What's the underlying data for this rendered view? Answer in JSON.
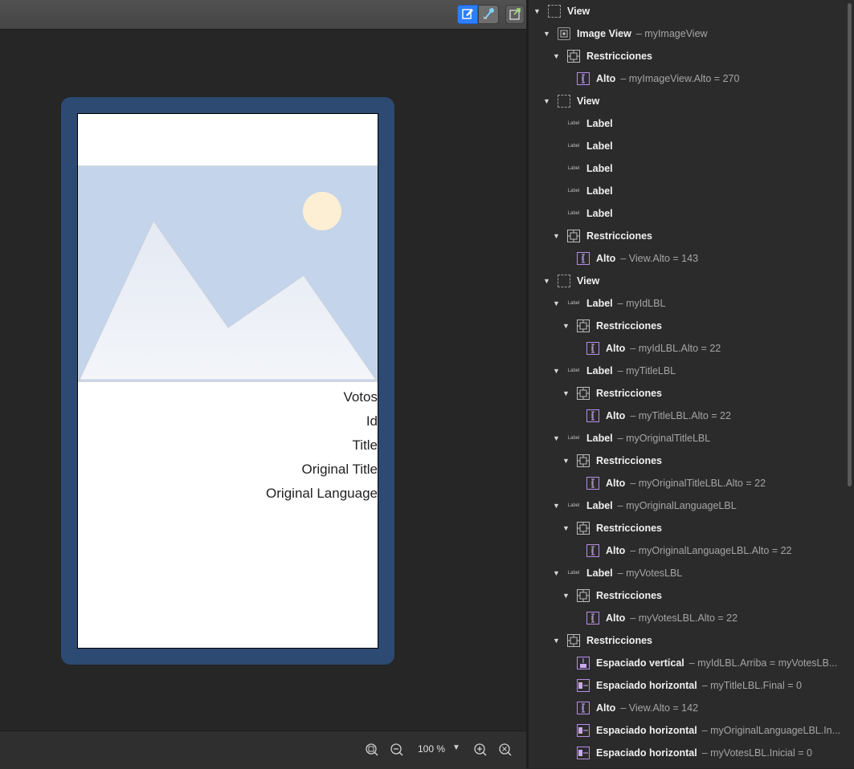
{
  "canvas": {
    "zoom_label": "100 %",
    "labels": [
      "Votos",
      "Id",
      "Title",
      "Original Title",
      "Original Language"
    ]
  },
  "outline": [
    {
      "depth": 0,
      "icon": "view",
      "name": "View",
      "detail": "",
      "expanded": true
    },
    {
      "depth": 1,
      "icon": "image",
      "name": "Image View",
      "detail": "– myImageView",
      "expanded": true
    },
    {
      "depth": 2,
      "icon": "constraints",
      "name": "Restricciones",
      "detail": "",
      "expanded": true
    },
    {
      "depth": 3,
      "icon": "constraint-height",
      "name": "Alto",
      "detail": "– myImageView.Alto = 270",
      "expanded": null
    },
    {
      "depth": 1,
      "icon": "view",
      "name": "View",
      "detail": "",
      "expanded": true
    },
    {
      "depth": 2,
      "icon": "label",
      "name": "Label",
      "detail": "",
      "expanded": null
    },
    {
      "depth": 2,
      "icon": "label",
      "name": "Label",
      "detail": "",
      "expanded": null
    },
    {
      "depth": 2,
      "icon": "label",
      "name": "Label",
      "detail": "",
      "expanded": null
    },
    {
      "depth": 2,
      "icon": "label",
      "name": "Label",
      "detail": "",
      "expanded": null
    },
    {
      "depth": 2,
      "icon": "label",
      "name": "Label",
      "detail": "",
      "expanded": null
    },
    {
      "depth": 2,
      "icon": "constraints",
      "name": "Restricciones",
      "detail": "",
      "expanded": true
    },
    {
      "depth": 3,
      "icon": "constraint-height",
      "name": "Alto",
      "detail": "– View.Alto = 143",
      "expanded": null
    },
    {
      "depth": 1,
      "icon": "view",
      "name": "View",
      "detail": "",
      "expanded": true
    },
    {
      "depth": 2,
      "icon": "label",
      "name": "Label",
      "detail": "– myIdLBL",
      "expanded": true
    },
    {
      "depth": 3,
      "icon": "constraints",
      "name": "Restricciones",
      "detail": "",
      "expanded": true
    },
    {
      "depth": 4,
      "icon": "constraint-height",
      "name": "Alto",
      "detail": "– myIdLBL.Alto = 22",
      "expanded": null
    },
    {
      "depth": 2,
      "icon": "label",
      "name": "Label",
      "detail": "– myTitleLBL",
      "expanded": true
    },
    {
      "depth": 3,
      "icon": "constraints",
      "name": "Restricciones",
      "detail": "",
      "expanded": true
    },
    {
      "depth": 4,
      "icon": "constraint-height",
      "name": "Alto",
      "detail": "– myTitleLBL.Alto = 22",
      "expanded": null
    },
    {
      "depth": 2,
      "icon": "label",
      "name": "Label",
      "detail": "– myOriginalTitleLBL",
      "expanded": true
    },
    {
      "depth": 3,
      "icon": "constraints",
      "name": "Restricciones",
      "detail": "",
      "expanded": true
    },
    {
      "depth": 4,
      "icon": "constraint-height",
      "name": "Alto",
      "detail": "– myOriginalTitleLBL.Alto = 22",
      "expanded": null
    },
    {
      "depth": 2,
      "icon": "label",
      "name": "Label",
      "detail": "– myOriginalLanguageLBL",
      "expanded": true
    },
    {
      "depth": 3,
      "icon": "constraints",
      "name": "Restricciones",
      "detail": "",
      "expanded": true
    },
    {
      "depth": 4,
      "icon": "constraint-height",
      "name": "Alto",
      "detail": "– myOriginalLanguageLBL.Alto = 22",
      "expanded": null
    },
    {
      "depth": 2,
      "icon": "label",
      "name": "Label",
      "detail": "– myVotesLBL",
      "expanded": true
    },
    {
      "depth": 3,
      "icon": "constraints",
      "name": "Restricciones",
      "detail": "",
      "expanded": true
    },
    {
      "depth": 4,
      "icon": "constraint-height",
      "name": "Alto",
      "detail": "– myVotesLBL.Alto = 22",
      "expanded": null
    },
    {
      "depth": 2,
      "icon": "constraints",
      "name": "Restricciones",
      "detail": "",
      "expanded": true
    },
    {
      "depth": 3,
      "icon": "constraint-vertical",
      "name": "Espaciado vertical",
      "detail": "– myIdLBL.Arriba = myVotesLB...",
      "expanded": null
    },
    {
      "depth": 3,
      "icon": "constraint-horizontal",
      "name": "Espaciado horizontal",
      "detail": "– myTitleLBL.Final = 0",
      "expanded": null
    },
    {
      "depth": 3,
      "icon": "constraint-height",
      "name": "Alto",
      "detail": "– View.Alto = 142",
      "expanded": null
    },
    {
      "depth": 3,
      "icon": "constraint-horizontal",
      "name": "Espaciado horizontal",
      "detail": "– myOriginalLanguageLBL.In...",
      "expanded": null
    },
    {
      "depth": 3,
      "icon": "constraint-horizontal",
      "name": "Espaciado horizontal",
      "detail": "– myVotesLBL.Inicial = 0",
      "expanded": null
    }
  ]
}
